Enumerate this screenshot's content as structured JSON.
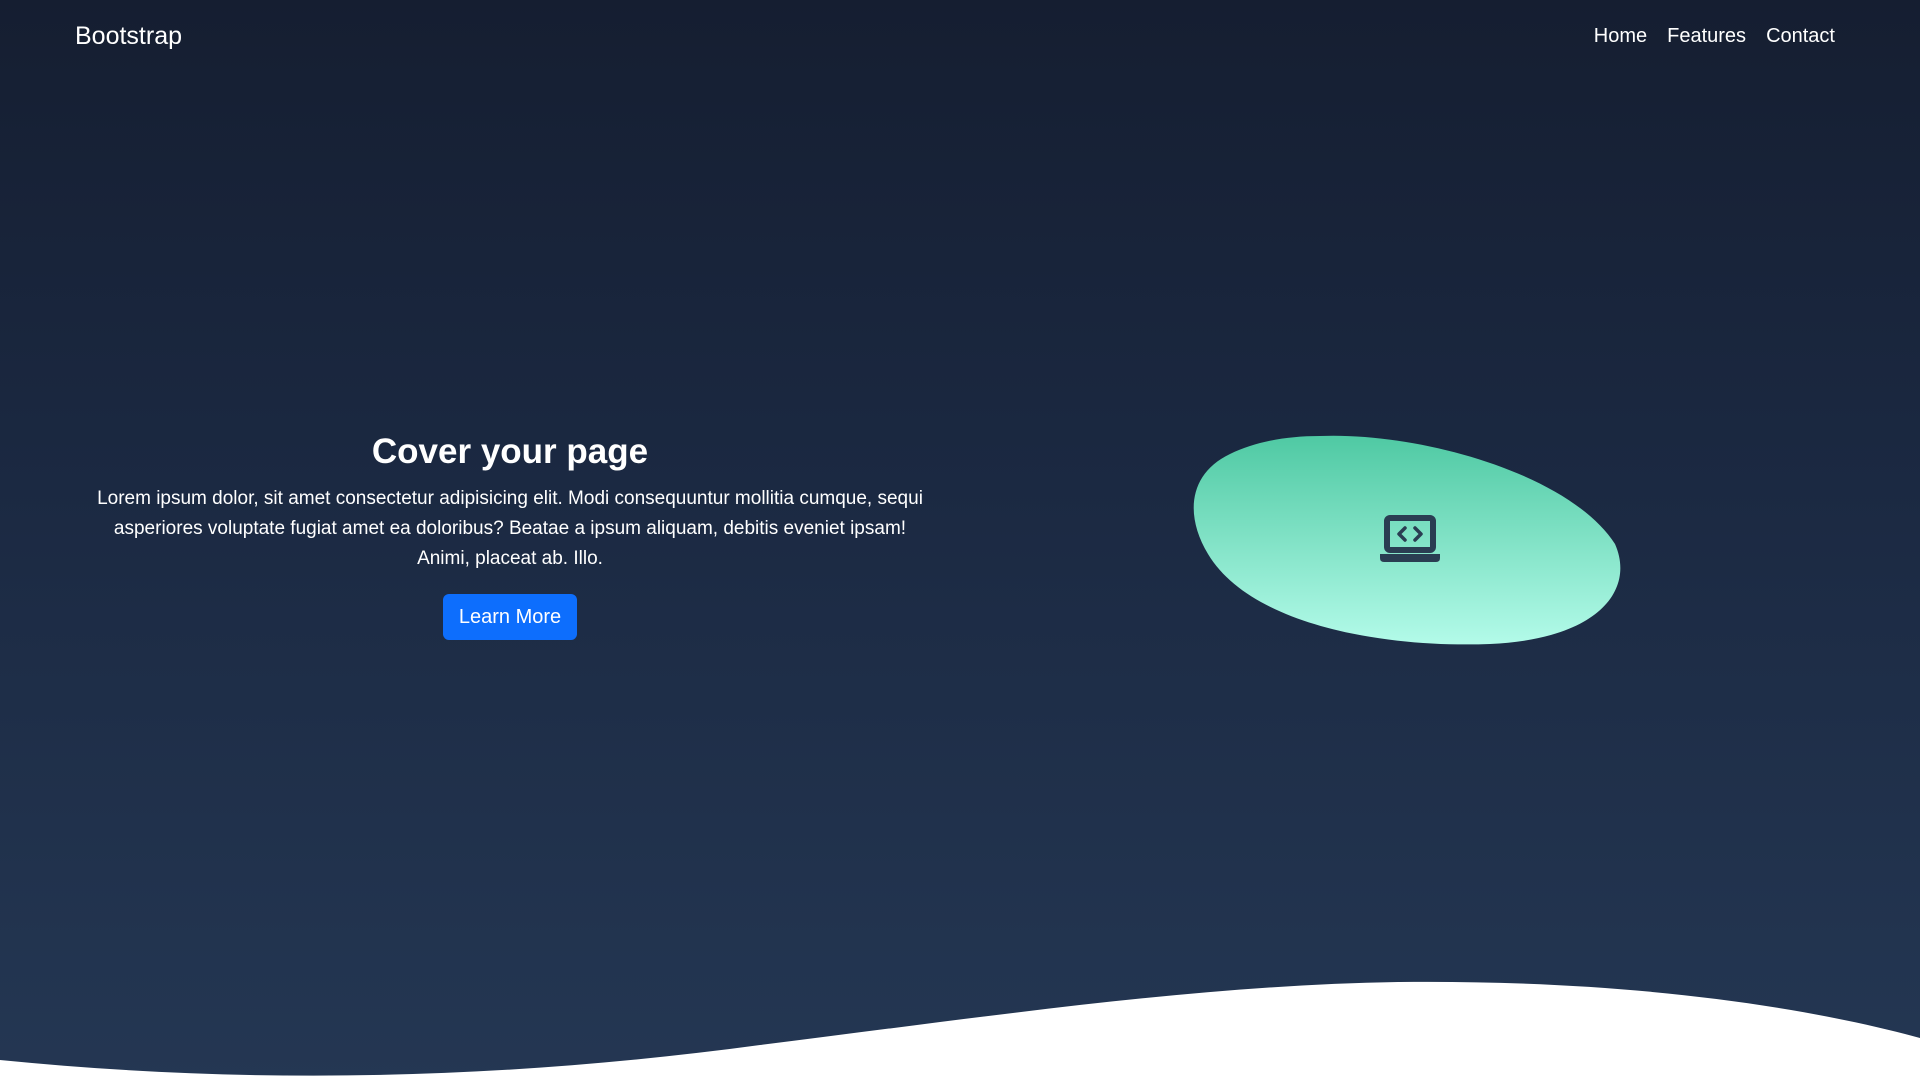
{
  "navbar": {
    "brand": "Bootstrap",
    "links": [
      "Home",
      "Features",
      "Contact"
    ]
  },
  "hero": {
    "title": "Cover your page",
    "text": "Lorem ipsum dolor, sit amet consectetur adipisicing elit. Modi consequuntur mollitia cumque, sequi asperiores voluptate fugiat amet ea doloribus? Beatae a ipsum aliquam, debitis eveniet ipsam! Animi, placeat ab. Illo.",
    "button_label": "Learn More"
  },
  "illustration": {
    "icon": "laptop-code-icon",
    "gradient_top": "#4fc9a3",
    "gradient_bottom": "#b3fbe9"
  },
  "colors": {
    "background_top": "#151e31",
    "background_bottom": "#243753",
    "accent_button": "#0d6efd",
    "icon_color": "#2a3d52"
  }
}
